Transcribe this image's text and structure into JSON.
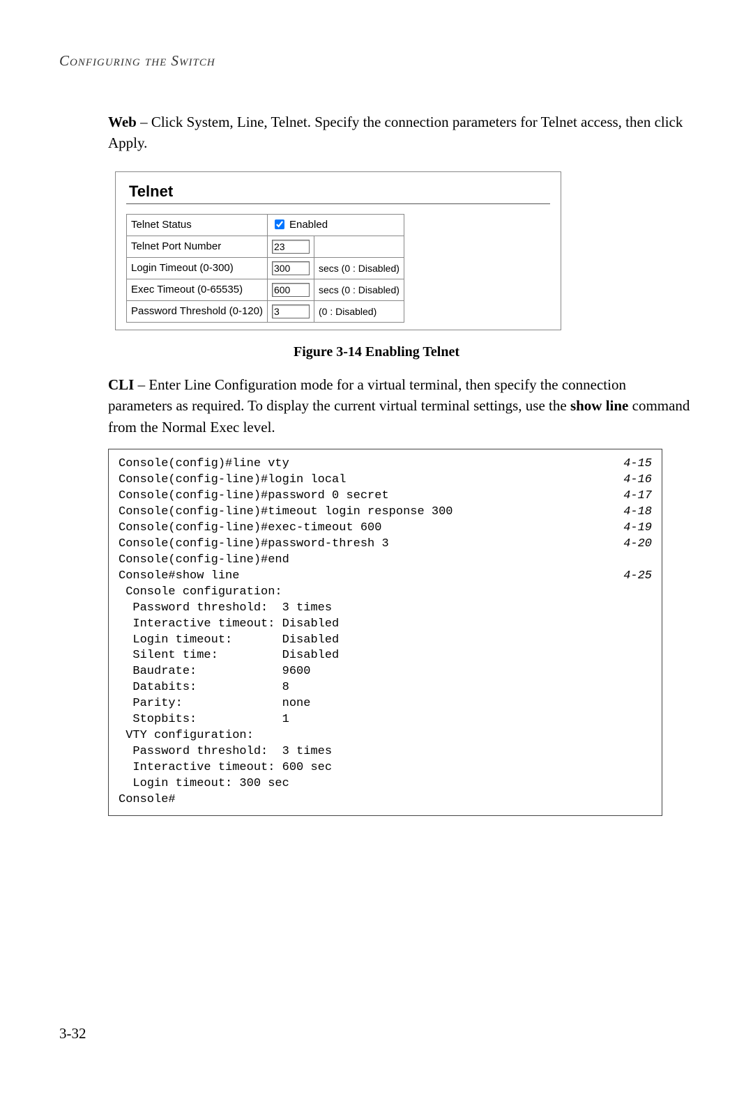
{
  "header": "Configuring the Switch",
  "web_para": {
    "prefix": "Web",
    "text": " – Click System, Line, Telnet. Specify the connection parameters for Telnet access, then click Apply."
  },
  "screenshot": {
    "title": "Telnet",
    "rows": [
      {
        "label": "Telnet Status",
        "type": "checkbox",
        "checked": true,
        "text": "Enabled"
      },
      {
        "label": "Telnet Port Number",
        "type": "input",
        "value": "23",
        "hint": ""
      },
      {
        "label": "Login Timeout (0-300)",
        "type": "input",
        "value": "300",
        "hint": "secs (0 : Disabled)"
      },
      {
        "label": "Exec Timeout (0-65535)",
        "type": "input",
        "value": "600",
        "hint": "secs (0 : Disabled)"
      },
      {
        "label": "Password Threshold (0-120)",
        "type": "input",
        "value": "3",
        "hint": "(0 : Disabled)"
      }
    ]
  },
  "figure_caption": "Figure 3-14  Enabling Telnet",
  "cli_para": {
    "prefix": "CLI",
    "text_before": " – Enter Line Configuration mode for a virtual terminal, then specify the connection parameters as required. To display the current virtual terminal settings, use the ",
    "bold": "show line",
    "text_after": " command from the Normal Exec level."
  },
  "cli_lines": [
    {
      "cmd": "Console(config)#line vty",
      "ref": "4-15"
    },
    {
      "cmd": "Console(config-line)#login local",
      "ref": "4-16"
    },
    {
      "cmd": "Console(config-line)#password 0 secret",
      "ref": "4-17"
    },
    {
      "cmd": "Console(config-line)#timeout login response 300",
      "ref": "4-18"
    },
    {
      "cmd": "Console(config-line)#exec-timeout 600",
      "ref": "4-19"
    },
    {
      "cmd": "Console(config-line)#password-thresh 3",
      "ref": "4-20"
    },
    {
      "cmd": "Console(config-line)#end",
      "ref": ""
    },
    {
      "cmd": "Console#show line",
      "ref": "4-25"
    },
    {
      "cmd": " Console configuration:",
      "ref": ""
    },
    {
      "cmd": "  Password threshold:  3 times",
      "ref": ""
    },
    {
      "cmd": "  Interactive timeout: Disabled",
      "ref": ""
    },
    {
      "cmd": "  Login timeout:       Disabled",
      "ref": ""
    },
    {
      "cmd": "  Silent time:         Disabled",
      "ref": ""
    },
    {
      "cmd": "  Baudrate:            9600",
      "ref": ""
    },
    {
      "cmd": "  Databits:            8",
      "ref": ""
    },
    {
      "cmd": "  Parity:              none",
      "ref": ""
    },
    {
      "cmd": "  Stopbits:            1",
      "ref": ""
    },
    {
      "cmd": "",
      "ref": ""
    },
    {
      "cmd": " VTY configuration:",
      "ref": ""
    },
    {
      "cmd": "  Password threshold:  3 times",
      "ref": ""
    },
    {
      "cmd": "  Interactive timeout: 600 sec",
      "ref": ""
    },
    {
      "cmd": "  Login timeout: 300 sec",
      "ref": ""
    },
    {
      "cmd": "Console#",
      "ref": ""
    }
  ],
  "page_number": "3-32"
}
